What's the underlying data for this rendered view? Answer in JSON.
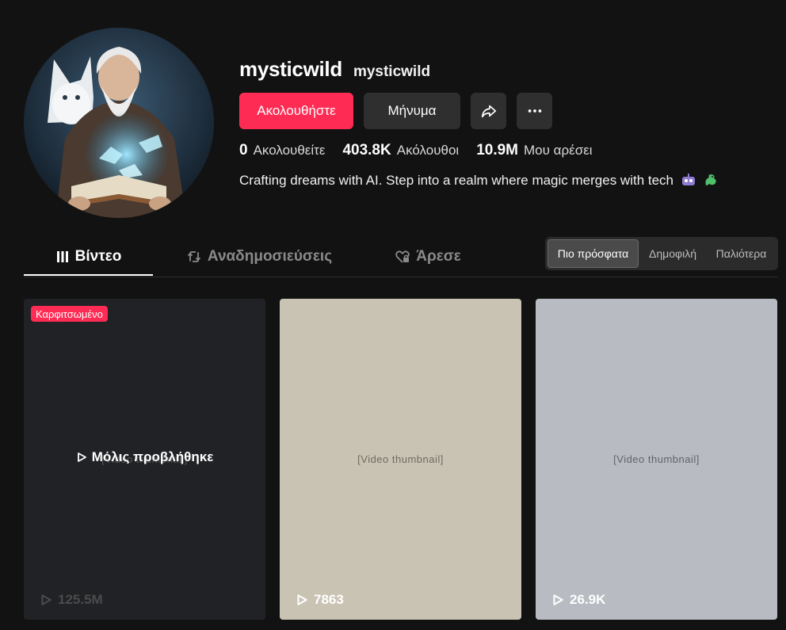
{
  "profile": {
    "unique_id": "mysticwild",
    "nickname": "mysticwild",
    "bio": "Crafting dreams with AI. Step into a realm where magic merges with tech",
    "bio_emoji_icons": [
      "robot-emoji-icon",
      "dragon-emoji-icon"
    ]
  },
  "actions": {
    "follow_label": "Ακολουθήστε",
    "message_label": "Μήνυμα",
    "share_icon": "share-icon",
    "more_icon": "more-icon"
  },
  "stats": [
    {
      "value": "0",
      "label": "Ακολουθείτε"
    },
    {
      "value": "403.8K",
      "label": "Ακόλουθοι"
    },
    {
      "value": "10.9M",
      "label": "Μου αρέσει"
    }
  ],
  "tabs": [
    {
      "label": "Βίντεο",
      "icon": "grid-icon",
      "active": true
    },
    {
      "label": "Αναδημοσιεύσεις",
      "icon": "repost-icon",
      "active": false
    },
    {
      "label": "Άρεσε",
      "icon": "heart-lock-icon",
      "active": false
    }
  ],
  "sort_options": [
    {
      "label": "Πιο πρόσφατα",
      "active": true
    },
    {
      "label": "Δημοφιλή",
      "active": false
    },
    {
      "label": "Παλιότερα",
      "active": false
    }
  ],
  "videos": [
    {
      "pinned_label": "Καρφιτσωμένο",
      "overlay_label": "Μόλις προβλήθηκε",
      "plays": "125.5M"
    },
    {
      "plays": "7863"
    },
    {
      "plays": "26.9K"
    }
  ],
  "colors": {
    "background": "#121212",
    "accent": "#fe2c55",
    "button_secondary": "#2f2f2f",
    "muted_text": "#8a8a8a"
  }
}
